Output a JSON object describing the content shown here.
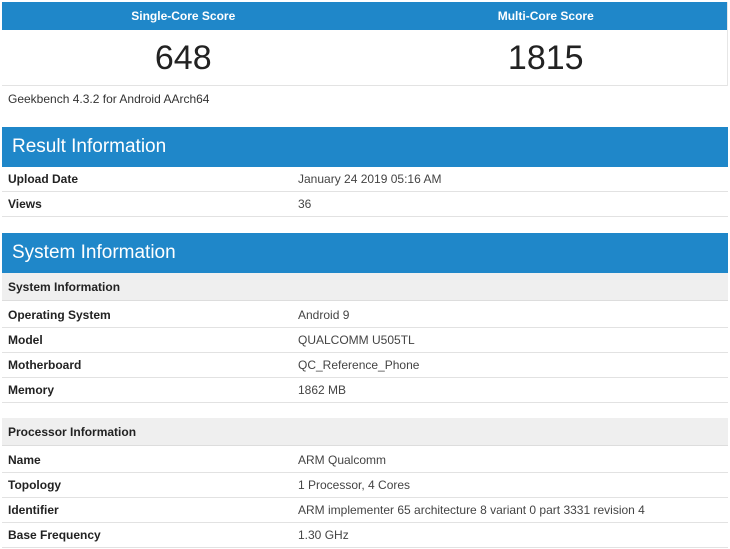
{
  "scores": {
    "single_label": "Single-Core Score",
    "multi_label": "Multi-Core Score",
    "single_value": "648",
    "multi_value": "1815"
  },
  "version": "Geekbench 4.3.2 for Android AArch64",
  "result": {
    "title": "Result Information",
    "rows": [
      {
        "key": "Upload Date",
        "value": "January 24 2019 05:16 AM"
      },
      {
        "key": "Views",
        "value": "36"
      }
    ]
  },
  "system": {
    "title": "System Information",
    "subsection": "System Information",
    "rows": [
      {
        "key": "Operating System",
        "value": "Android 9"
      },
      {
        "key": "Model",
        "value": "QUALCOMM U505TL"
      },
      {
        "key": "Motherboard",
        "value": "QC_Reference_Phone"
      },
      {
        "key": "Memory",
        "value": "1862 MB"
      }
    ]
  },
  "processor": {
    "subsection": "Processor Information",
    "rows": [
      {
        "key": "Name",
        "value": "ARM Qualcomm"
      },
      {
        "key": "Topology",
        "value": "1 Processor, 4 Cores"
      },
      {
        "key": "Identifier",
        "value": "ARM implementer 65 architecture 8 variant 0 part 3331 revision 4"
      },
      {
        "key": "Base Frequency",
        "value": "1.30 GHz"
      }
    ]
  },
  "colors": {
    "header_blue": "#1f87c9",
    "subhead_gray": "#efefef"
  }
}
